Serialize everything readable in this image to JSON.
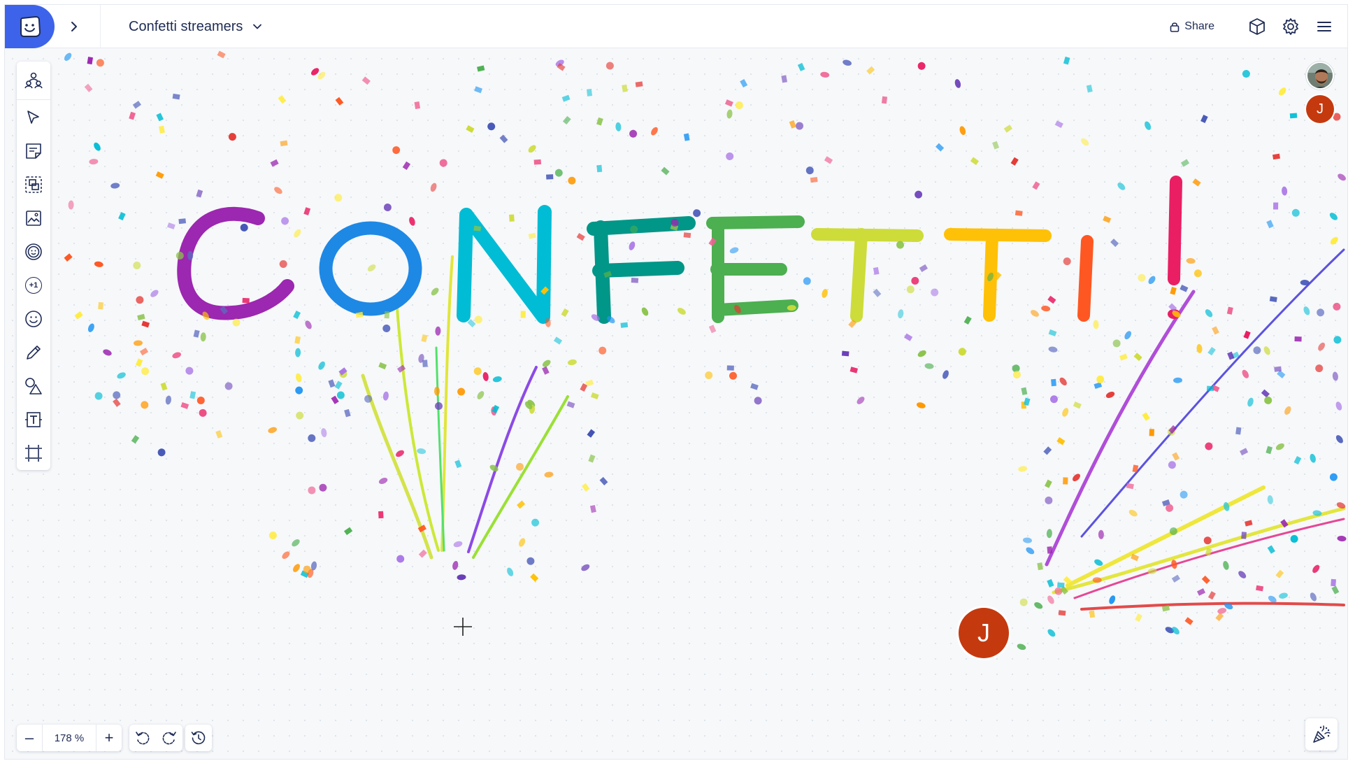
{
  "header": {
    "board_title": "Confetti streamers",
    "share_label": "Share"
  },
  "icons": {
    "logo": "app-logo-icon",
    "expand": "chevron-right-icon",
    "title_dropdown": "chevron-down-icon",
    "share": "lock-icon",
    "templates": "cube-icon",
    "settings": "gear-icon",
    "menu": "hamburger-menu-icon"
  },
  "toolbar": {
    "tools": [
      {
        "name": "collaborators",
        "icon": "people-icon"
      },
      {
        "name": "select",
        "icon": "cursor-icon"
      },
      {
        "name": "sticky-note",
        "icon": "note-icon"
      },
      {
        "name": "group",
        "icon": "group-icon"
      },
      {
        "name": "image",
        "icon": "image-icon"
      },
      {
        "name": "stamp",
        "icon": "stamp-icon"
      },
      {
        "name": "vote",
        "icon": "plus-one-icon"
      },
      {
        "name": "emoji",
        "icon": "smiley-icon"
      },
      {
        "name": "pen",
        "icon": "pencil-icon"
      },
      {
        "name": "shapes",
        "icon": "shapes-icon"
      },
      {
        "name": "text",
        "icon": "text-icon"
      },
      {
        "name": "frame",
        "icon": "frame-icon"
      }
    ],
    "plus_one_label": "+1"
  },
  "canvas": {
    "drawn_word_letters": [
      "C",
      "O",
      "N",
      "F",
      "E",
      "T",
      "T",
      "I",
      "!"
    ],
    "letter_colors": [
      "#9c27b0",
      "#1e88e5",
      "#00bcd4",
      "#009688",
      "#4caf50",
      "#cddc39",
      "#ffc107",
      "#ff5722",
      "#e91e63"
    ]
  },
  "presence": {
    "users": [
      {
        "type": "photo",
        "label": ""
      },
      {
        "type": "initial",
        "label": "J",
        "color": "#c5390f"
      }
    ],
    "cursor_label": "J"
  },
  "zoom": {
    "minus": "–",
    "value": "178 %",
    "plus": "+"
  },
  "bottom_icons": {
    "undo": "undo-icon",
    "redo": "redo-icon",
    "history": "history-icon",
    "celebrate": "party-popper-icon"
  }
}
